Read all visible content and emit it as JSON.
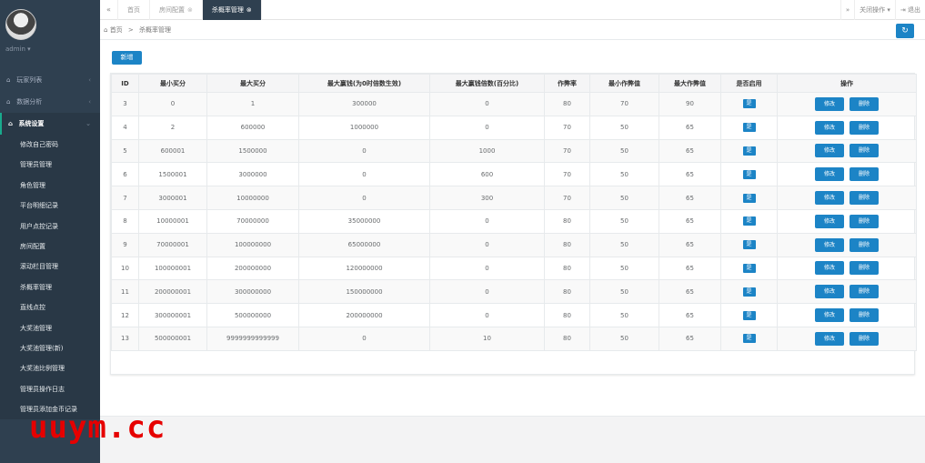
{
  "sidebar": {
    "admin_name": "admin ▾",
    "menu": [
      {
        "label": "玩家列表",
        "icon": "home-icon"
      },
      {
        "label": "数据分析",
        "icon": "home-icon"
      },
      {
        "label": "系统设置",
        "icon": "home-icon",
        "active": true
      }
    ],
    "submenu": [
      "修改自己密码",
      "管理员管理",
      "角色管理",
      "平台明细记录",
      "用户点控记录",
      "房间配置",
      "滚动栏目管理",
      "杀概率管理",
      "直线点控",
      "大奖池管理",
      "大奖池管理(新)",
      "大奖池比例管理",
      "管理员操作日志",
      "管理员添加金币记录"
    ]
  },
  "topbar": {
    "tabs": [
      {
        "label": "首页",
        "closable": false
      },
      {
        "label": "房间配置",
        "closable": true
      },
      {
        "label": "杀概率管理",
        "closable": true,
        "active": true
      }
    ],
    "close_ops": "关闭操作 ▾",
    "logout": "退出"
  },
  "breadcrumb": {
    "home": "首页",
    "current": "杀概率管理"
  },
  "add_button": "新增",
  "table": {
    "headers": [
      "ID",
      "最小买分",
      "最大买分",
      "最大赢钱(为0时倍数生效)",
      "最大赢钱倍数(百分比)",
      "作弊率",
      "最小作弊值",
      "最大作弊值",
      "是否启用",
      "操作"
    ],
    "rows": [
      [
        "3",
        "0",
        "1",
        "300000",
        "0",
        "80",
        "70",
        "90",
        "是"
      ],
      [
        "4",
        "2",
        "600000",
        "1000000",
        "0",
        "70",
        "50",
        "65",
        "是"
      ],
      [
        "5",
        "600001",
        "1500000",
        "0",
        "1000",
        "70",
        "50",
        "65",
        "是"
      ],
      [
        "6",
        "1500001",
        "3000000",
        "0",
        "600",
        "70",
        "50",
        "65",
        "是"
      ],
      [
        "7",
        "3000001",
        "10000000",
        "0",
        "300",
        "70",
        "50",
        "65",
        "是"
      ],
      [
        "8",
        "10000001",
        "70000000",
        "35000000",
        "0",
        "80",
        "50",
        "65",
        "是"
      ],
      [
        "9",
        "70000001",
        "100000000",
        "65000000",
        "0",
        "80",
        "50",
        "65",
        "是"
      ],
      [
        "10",
        "100000001",
        "200000000",
        "120000000",
        "0",
        "80",
        "50",
        "65",
        "是"
      ],
      [
        "11",
        "200000001",
        "300000000",
        "150000000",
        "0",
        "80",
        "50",
        "65",
        "是"
      ],
      [
        "12",
        "300000001",
        "500000000",
        "200000000",
        "0",
        "80",
        "50",
        "65",
        "是"
      ],
      [
        "13",
        "500000001",
        "9999999999999",
        "0",
        "10",
        "80",
        "50",
        "65",
        "是"
      ]
    ],
    "edit_label": "修改",
    "delete_label": "删除"
  },
  "watermark": "uuym.cc",
  "colors": {
    "sidebar": "#2f4050",
    "primary": "#1c84c6",
    "watermark": "#e60000"
  }
}
